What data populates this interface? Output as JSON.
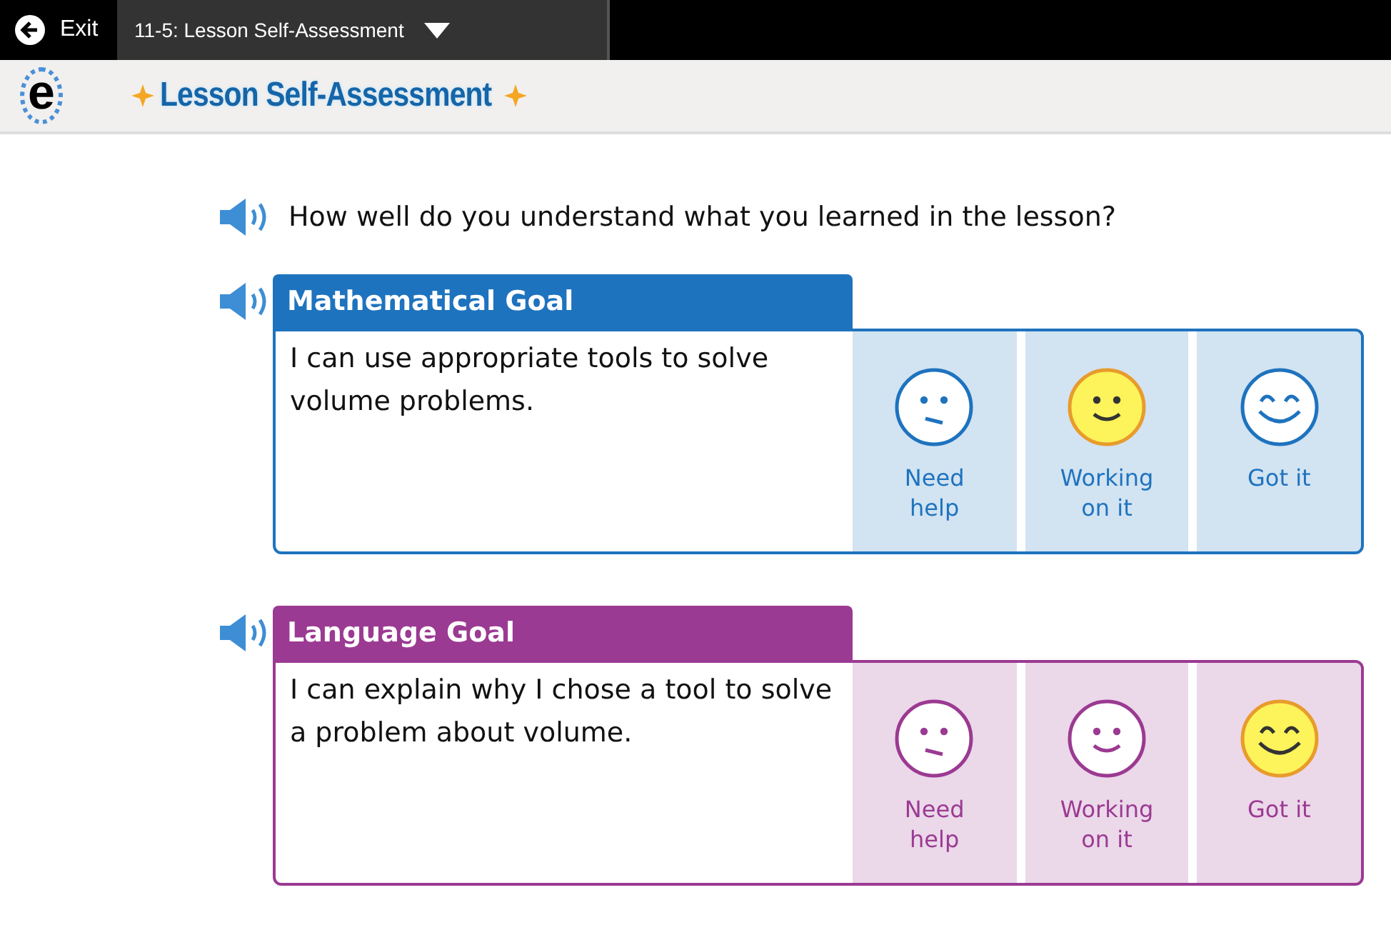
{
  "topbar": {
    "exit": "Exit",
    "lesson_menu": "11-5: Lesson Self-Assessment"
  },
  "header": {
    "logo": "e",
    "title": "Lesson Self-Assessment"
  },
  "question": "How well do you understand what you learned in the lesson?",
  "goals": [
    {
      "title": "Mathematical Goal",
      "color": "#1e73be",
      "statement": "I can use appropriate tools to solve volume problems.",
      "options": [
        {
          "label": "Need help",
          "kind": "unsure",
          "selected": false
        },
        {
          "label": "Working on it",
          "kind": "smile",
          "selected": true
        },
        {
          "label": "Got it",
          "kind": "happy",
          "selected": false
        }
      ]
    },
    {
      "title": "Language Goal",
      "color": "#9b3a92",
      "statement": "I can explain why I chose a tool to solve a problem about volume.",
      "options": [
        {
          "label": "Need help",
          "kind": "unsure",
          "selected": false
        },
        {
          "label": "Working on it",
          "kind": "smile",
          "selected": false
        },
        {
          "label": "Got it",
          "kind": "happy",
          "selected": true
        }
      ]
    }
  ]
}
